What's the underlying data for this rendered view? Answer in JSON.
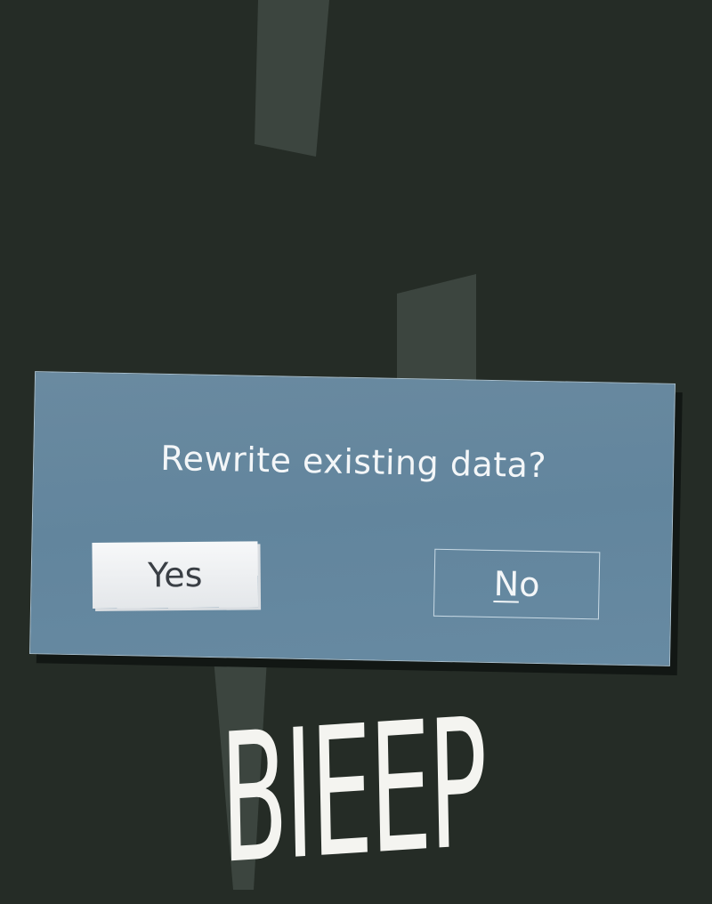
{
  "dialog": {
    "message": "Rewrite existing data?",
    "yes_label": "Yes",
    "no_label_mnemonic": "N",
    "no_label_rest": "o"
  },
  "sound_effect": "BIEEP",
  "colors": {
    "background": "#252c26",
    "dialog_fill": "#6a8aa0",
    "dialog_border": "#a9c0cf",
    "yes_button_fill": "#eef0f2",
    "text_light": "#f3f6f8",
    "text_dark": "#3a3f45"
  }
}
